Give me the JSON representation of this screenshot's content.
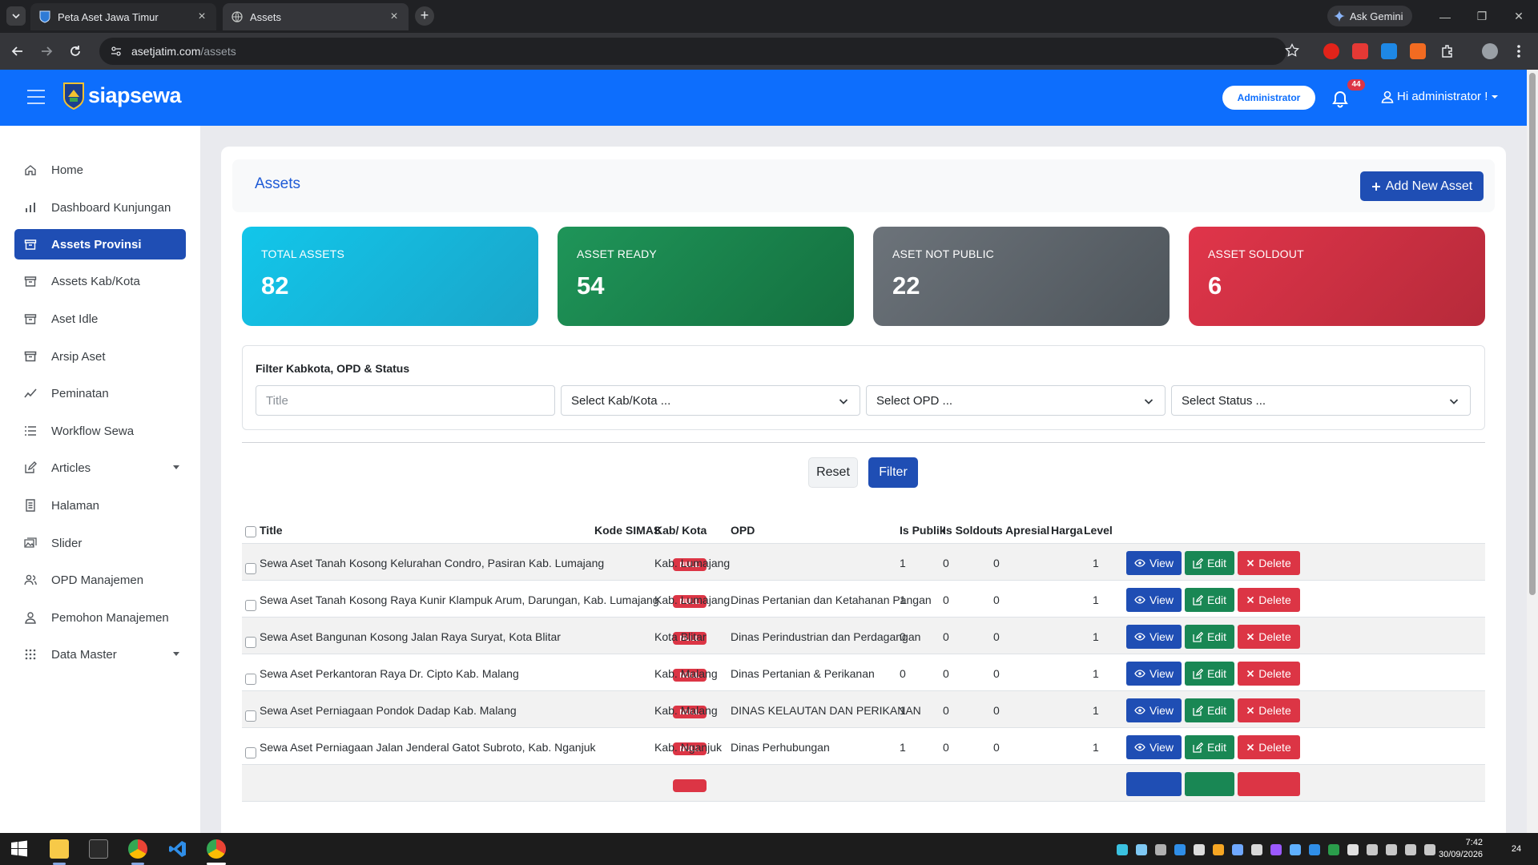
{
  "browser": {
    "tabs": [
      {
        "label": "Peta Aset Jawa Timur"
      },
      {
        "label": "Assets"
      }
    ],
    "gemini_label": "Ask Gemini",
    "url_host": "asetjatim.com",
    "url_path": "/assets"
  },
  "header": {
    "logo_text": "siapsewa",
    "role_pill": "Administrator",
    "notification_count": "44",
    "user_greeting": "Hi administrator !"
  },
  "sidebar": {
    "items": [
      {
        "label": "Home",
        "icon": "home-icon"
      },
      {
        "label": "Dashboard Kunjungan",
        "icon": "bar-chart-icon"
      },
      {
        "label": "Assets Provinsi",
        "icon": "archive-icon",
        "active": true
      },
      {
        "label": "Assets Kab/Kota",
        "icon": "archive-icon"
      },
      {
        "label": "Aset Idle",
        "icon": "archive-icon"
      },
      {
        "label": "Arsip Aset",
        "icon": "archive-box-icon"
      },
      {
        "label": "Peminatan",
        "icon": "trend-icon"
      },
      {
        "label": "Workflow Sewa",
        "icon": "list-icon"
      },
      {
        "label": "Articles",
        "icon": "edit-icon",
        "has_dropdown": true
      },
      {
        "label": "Halaman",
        "icon": "document-icon"
      },
      {
        "label": "Slider",
        "icon": "images-icon"
      },
      {
        "label": "OPD Manajemen",
        "icon": "users-icon"
      },
      {
        "label": "Pemohon Manajemen",
        "icon": "user-icon"
      },
      {
        "label": "Data Master",
        "icon": "grid-icon",
        "has_dropdown": true
      }
    ]
  },
  "page": {
    "title": "Assets",
    "add_button": "Add New Asset"
  },
  "stats": [
    {
      "label": "TOTAL ASSETS",
      "value": "82",
      "color": "#17c1e8"
    },
    {
      "label": "ASSET READY",
      "value": "54",
      "color": "#198754"
    },
    {
      "label": "ASET NOT PUBLIC",
      "value": "22",
      "color": "#5c636a"
    },
    {
      "label": "ASSET SOLDOUT",
      "value": "6",
      "color": "#dc3545"
    }
  ],
  "filter": {
    "title": "Filter Kabkota, OPD & Status",
    "title_placeholder": "Title",
    "kabkota_select": "Select Kab/Kota ...",
    "opd_select": "Select OPD ...",
    "status_select": "Select Status ...",
    "reset_label": "Reset",
    "filter_label": "Filter"
  },
  "table": {
    "columns": [
      "Title",
      "Kode SIMAS",
      "Kab/ Kota",
      "OPD",
      "Is Publik",
      "Is Soldout",
      "Is Apresial",
      "Harga",
      "Level"
    ],
    "actions": {
      "view": "View",
      "edit": "Edit",
      "delete": "Delete"
    },
    "rows": [
      {
        "title": "Sewa Aset Tanah Kosong Kelurahan Condro, Pasiran Kab. Lumajang",
        "kode": "NULL",
        "kab": "Kab. Lumajang",
        "opd": "",
        "publik": "1",
        "soldout": "0",
        "apresial": "0",
        "harga": "",
        "level": "1"
      },
      {
        "title": "Sewa Aset Tanah Kosong Raya Kunir Klampuk Arum, Darungan, Kab. Lumajang",
        "kode": "NULL",
        "kab": "Kab. Lumajang",
        "opd": "Dinas Pertanian dan Ketahanan Pangan",
        "publik": "1",
        "soldout": "0",
        "apresial": "0",
        "harga": "",
        "level": "1"
      },
      {
        "title": "Sewa Aset Bangunan Kosong Jalan Raya Suryat, Kota Blitar",
        "kode": "NULL",
        "kab": "Kota Blitar",
        "opd": "Dinas Perindustrian dan Perdagangan",
        "publik": "0",
        "soldout": "0",
        "apresial": "0",
        "harga": "",
        "level": "1"
      },
      {
        "title": "Sewa Aset Perkantoran Raya Dr. Cipto Kab. Malang",
        "kode": "NULL",
        "kab": "Kab. Malang",
        "opd": "Dinas Pertanian & Perikanan",
        "publik": "0",
        "soldout": "0",
        "apresial": "0",
        "harga": "",
        "level": "1"
      },
      {
        "title": "Sewa Aset Perniagaan Pondok Dadap Kab. Malang",
        "kode": "NULL",
        "kab": "Kab. Malang",
        "opd": "DINAS KELAUTAN DAN PERIKANAN",
        "publik": "1",
        "soldout": "0",
        "apresial": "0",
        "harga": "",
        "level": "1"
      },
      {
        "title": "Sewa Aset Perniagaan Jalan Jenderal Gatot Subroto, Kab. Nganjuk",
        "kode": "NULL",
        "kab": "Kab. Nganjuk",
        "opd": "Dinas Perhubungan",
        "publik": "1",
        "soldout": "0",
        "apresial": "0",
        "harga": "",
        "level": "1"
      }
    ]
  },
  "taskbar": {
    "time": "7:42",
    "date": "30/09/2026",
    "notification_count": "24"
  }
}
